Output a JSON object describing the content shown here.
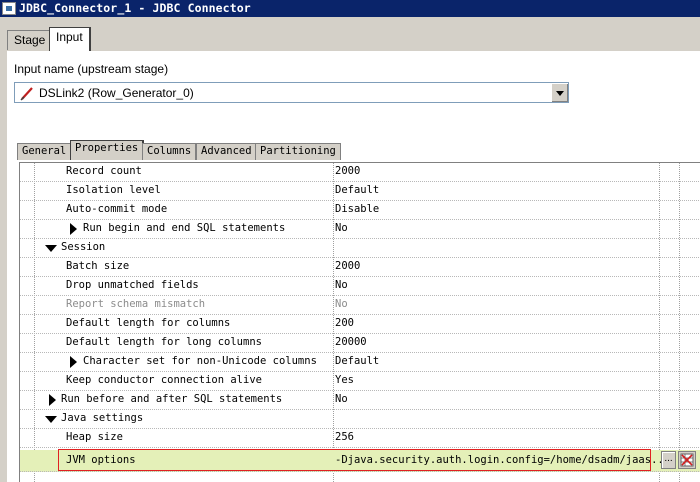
{
  "window": {
    "title": "JDBC_Connector_1 - JDBC Connector"
  },
  "top_tabs": [
    {
      "label": "Stage",
      "active": false
    },
    {
      "label": "Input",
      "active": true
    }
  ],
  "input": {
    "label": "Input name (upstream stage)",
    "selected": "DSLink2 (Row_Generator_0)"
  },
  "sub_tabs": [
    {
      "label": "General",
      "active": false
    },
    {
      "label": "Properties",
      "active": true
    },
    {
      "label": "Columns",
      "active": false
    },
    {
      "label": "Advanced",
      "active": false
    },
    {
      "label": "Partitioning",
      "active": false
    }
  ],
  "properties": [
    {
      "name": "Record count",
      "value": "2000"
    },
    {
      "name": "Isolation level",
      "value": "Default"
    },
    {
      "name": "Auto-commit mode",
      "value": "Disable"
    },
    {
      "name": "Run begin and end SQL statements",
      "value": "No"
    },
    {
      "name": "Session",
      "value": ""
    },
    {
      "name": "Batch size",
      "value": "2000"
    },
    {
      "name": "Drop unmatched fields",
      "value": "No"
    },
    {
      "name": "Report schema mismatch",
      "value": "No"
    },
    {
      "name": "Default length for columns",
      "value": "200"
    },
    {
      "name": "Default length for long columns",
      "value": "20000"
    },
    {
      "name": "Character set for non-Unicode columns",
      "value": "Default"
    },
    {
      "name": "Keep conductor connection alive",
      "value": "Yes"
    },
    {
      "name": "Run before and after SQL statements",
      "value": "No"
    },
    {
      "name": "Java settings",
      "value": ""
    },
    {
      "name": "Heap size",
      "value": "256"
    },
    {
      "name": "JVM options",
      "value": "-Djava.security.auth.login.config=/home/dsadm/jaas..."
    }
  ],
  "buttons": {
    "ellipsis": "..."
  },
  "colors": {
    "title_bar": "#0a246a",
    "selected_row": "#e4f0b8",
    "highlight": "#e02020"
  },
  "icons": {
    "input_link": "pencil-link-icon",
    "tool": "grid-tool-icon"
  }
}
